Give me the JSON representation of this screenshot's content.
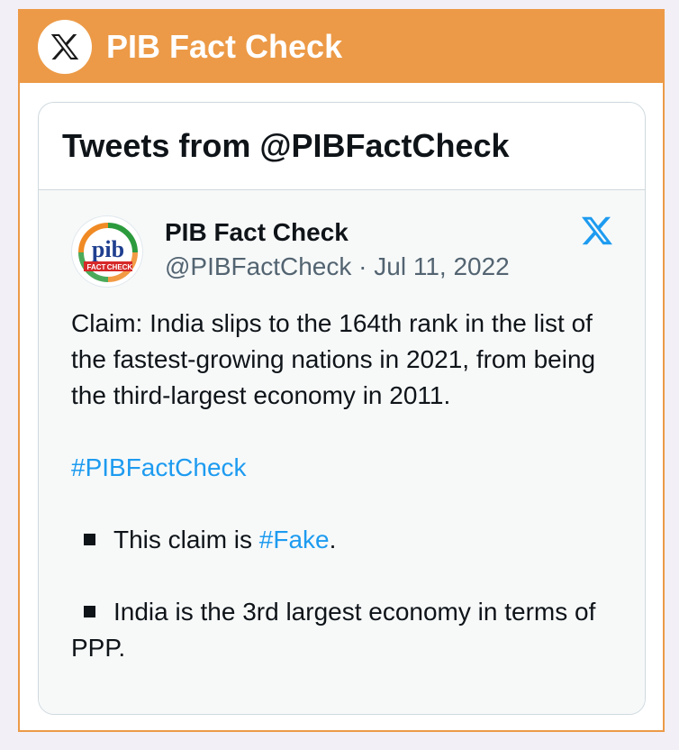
{
  "header": {
    "title": "PIB Fact Check",
    "logo_icon": "x-logo-icon"
  },
  "card": {
    "title": "Tweets from @PIBFactCheck"
  },
  "tweet": {
    "author_name": "PIB Fact Check",
    "handle": "@PIBFactCheck",
    "separator": "·",
    "date": "Jul 11, 2022",
    "avatar_text_main": "pib",
    "avatar_text_sub1": "FACT",
    "avatar_text_sub2": "CHECK",
    "claim": "Claim: India slips to the 164th rank in the list of the fastest-growing nations in 2021, from being the third-largest economy in 2011.",
    "hashtag_main": "#PIBFactCheck",
    "bullet1_prefix": "This claim is ",
    "bullet1_hashtag": "#Fake",
    "bullet1_suffix": ".",
    "bullet2": "India is the 3rd largest economy in terms of PPP."
  },
  "colors": {
    "accent": "#ec9a47",
    "link": "#1d9bf0",
    "text": "#0f1419",
    "muted": "#536471"
  }
}
